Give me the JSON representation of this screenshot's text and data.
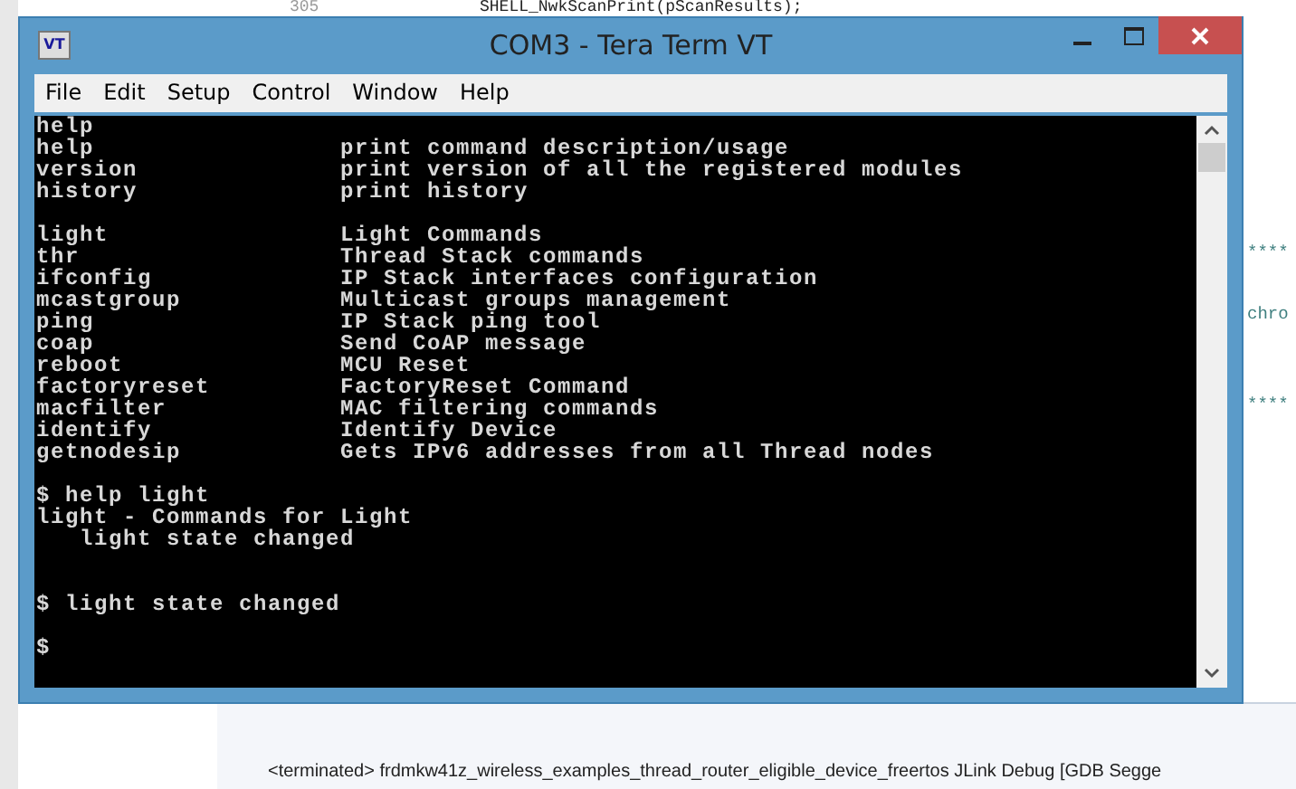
{
  "background": {
    "line_number": "305",
    "code": "SHELL_NwkScanPrint(pScanResults);",
    "side_fragments": [
      "****",
      "chro",
      "****"
    ],
    "console_line": "<terminated> frdmkw41z_wireless_examples_thread_router_eligible_device_freertos JLink Debug [GDB Segge"
  },
  "window": {
    "title": "COM3 - Tera Term VT",
    "icon_text": "VT",
    "active": true
  },
  "menu": [
    "File",
    "Edit",
    "Setup",
    "Control",
    "Window",
    "Help"
  ],
  "terminal": {
    "lines": [
      {
        "kind": "text",
        "text": "help"
      },
      {
        "kind": "row",
        "command": "help",
        "description": "print command description/usage"
      },
      {
        "kind": "row",
        "command": "version",
        "description": "print version of all the registered modules"
      },
      {
        "kind": "row",
        "command": "history",
        "description": "print history"
      },
      {
        "kind": "blank"
      },
      {
        "kind": "row",
        "command": "light",
        "description": "Light Commands"
      },
      {
        "kind": "row",
        "command": "thr",
        "description": "Thread Stack commands"
      },
      {
        "kind": "row",
        "command": "ifconfig",
        "description": "IP Stack interfaces configuration"
      },
      {
        "kind": "row",
        "command": "mcastgroup",
        "description": "Multicast groups management"
      },
      {
        "kind": "row",
        "command": "ping",
        "description": "IP Stack ping tool"
      },
      {
        "kind": "row",
        "command": "coap",
        "description": "Send CoAP message"
      },
      {
        "kind": "row",
        "command": "reboot",
        "description": "MCU Reset"
      },
      {
        "kind": "row",
        "command": "factoryreset",
        "description": "FactoryReset Command"
      },
      {
        "kind": "row",
        "command": "macfilter",
        "description": "MAC filtering commands"
      },
      {
        "kind": "row",
        "command": "identify",
        "description": "Identify Device"
      },
      {
        "kind": "row",
        "command": "getnodesip",
        "description": "Gets IPv6 addresses from all Thread nodes"
      },
      {
        "kind": "blank"
      },
      {
        "kind": "text",
        "text": "$ help light"
      },
      {
        "kind": "text",
        "text": "light - Commands for Light"
      },
      {
        "kind": "text",
        "text": "   light state changed"
      },
      {
        "kind": "blank"
      },
      {
        "kind": "blank"
      },
      {
        "kind": "text",
        "text": "$ light state changed"
      },
      {
        "kind": "blank"
      },
      {
        "kind": "text",
        "text": "$"
      }
    ]
  }
}
